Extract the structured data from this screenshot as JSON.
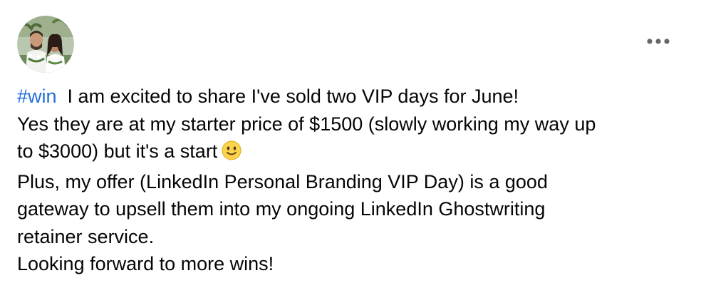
{
  "post": {
    "author_avatar": "profile-photo-couple",
    "more_icon": "more-options-icon",
    "hashtag": "#win",
    "line1_text": "I am excited to share I've sold two VIP days for June!",
    "line2": "Yes they are at my starter price of $1500 (slowly working my way up",
    "line3_text": "to $3000) but it's a start",
    "line3_emoji": "slightly-smiling-face-icon",
    "line4": "Plus, my offer (LinkedIn Personal Branding VIP Day) is a good",
    "line5": "gateway to upsell them into my ongoing LinkedIn Ghostwriting",
    "line6": "retainer service.",
    "line7": "Looking forward to more wins!"
  },
  "colors": {
    "hashtag": "#216fdb",
    "text": "#050505",
    "more_dots": "#65676b",
    "background": "#ffffff"
  }
}
